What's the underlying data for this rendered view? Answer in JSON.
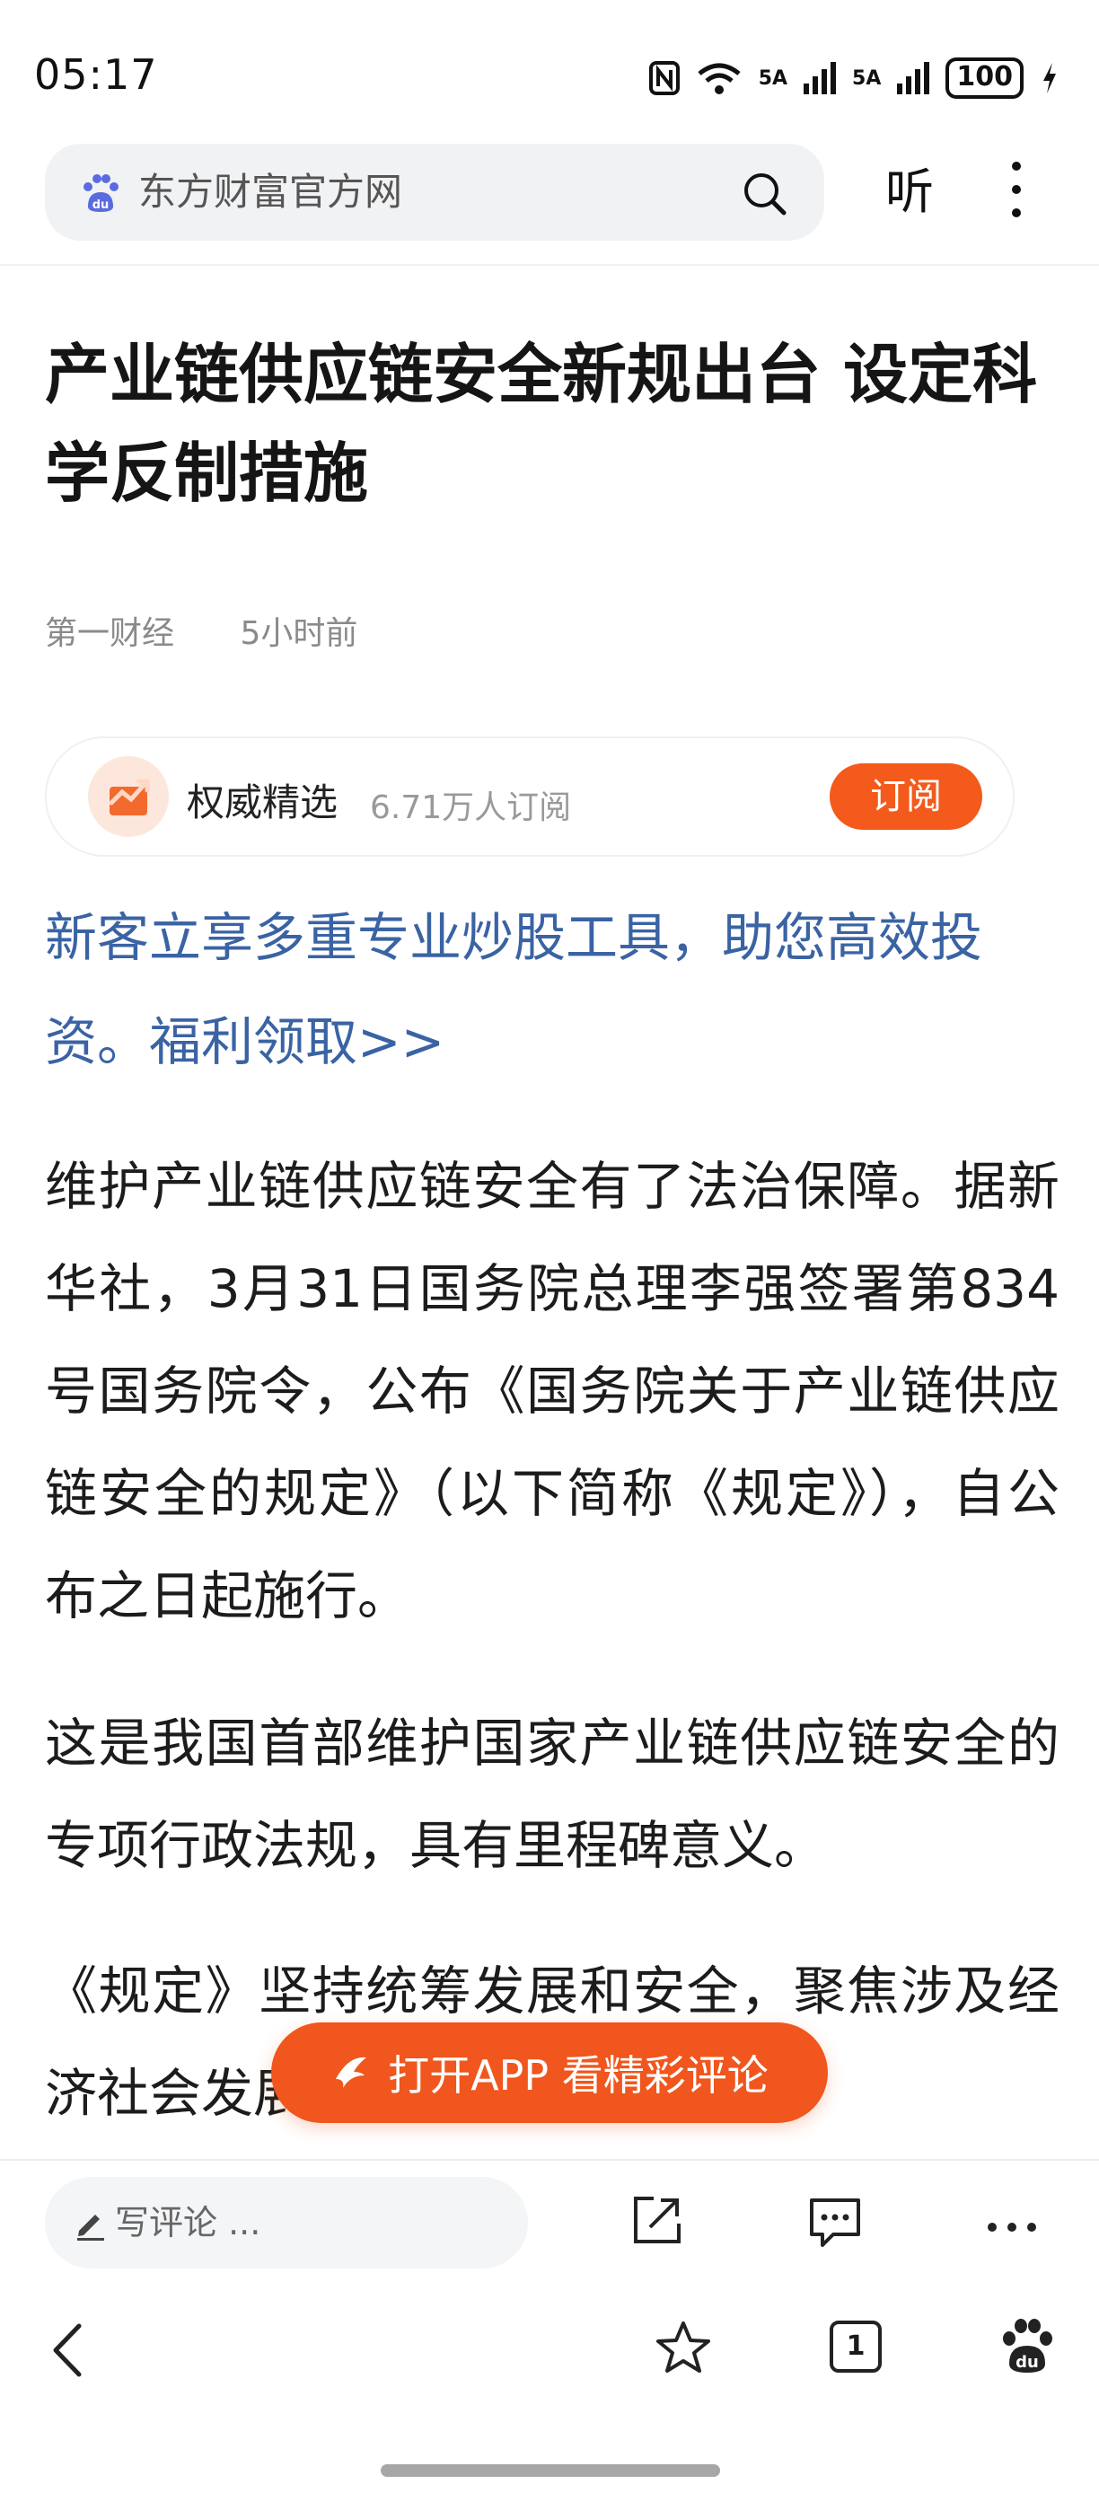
{
  "status_bar": {
    "time": "05:17",
    "network": "5A",
    "battery": "100"
  },
  "header": {
    "search_text": "东方财富官方网",
    "listen_label": "听"
  },
  "article": {
    "title": "产业链供应链安全新规出台 设定科学反制措施",
    "source": "第一财经",
    "time_ago": "5小时前",
    "promo": "新客立享多重专业炒股工具，助您高效投资。福利领取>>",
    "paragraphs": [
      "维护产业链供应链安全有了法治保障。据新华社，3月31日国务院总理李强签署第834号国务院令，公布《国务院关于产业链供应链安全的规定》（以下简称《规定》），自公布之日起施行。",
      "这是我国首部维护国家产业链供应链安全的专项行政法规，具有里程碑意义。",
      "《规定》坚持统筹发展和安全，聚焦涉及经济社会发展的重点行业关键领域"
    ]
  },
  "subscription": {
    "name": "权威精选",
    "count": "6.71万人订阅",
    "button": "订阅"
  },
  "open_app_button": "打开APP 看精彩评论",
  "comment_bar": {
    "placeholder": "写评论 ..."
  },
  "bottom_nav": {
    "tab_count": "1"
  },
  "colors": {
    "accent": "#f0561d",
    "link": "#3a63a4"
  }
}
